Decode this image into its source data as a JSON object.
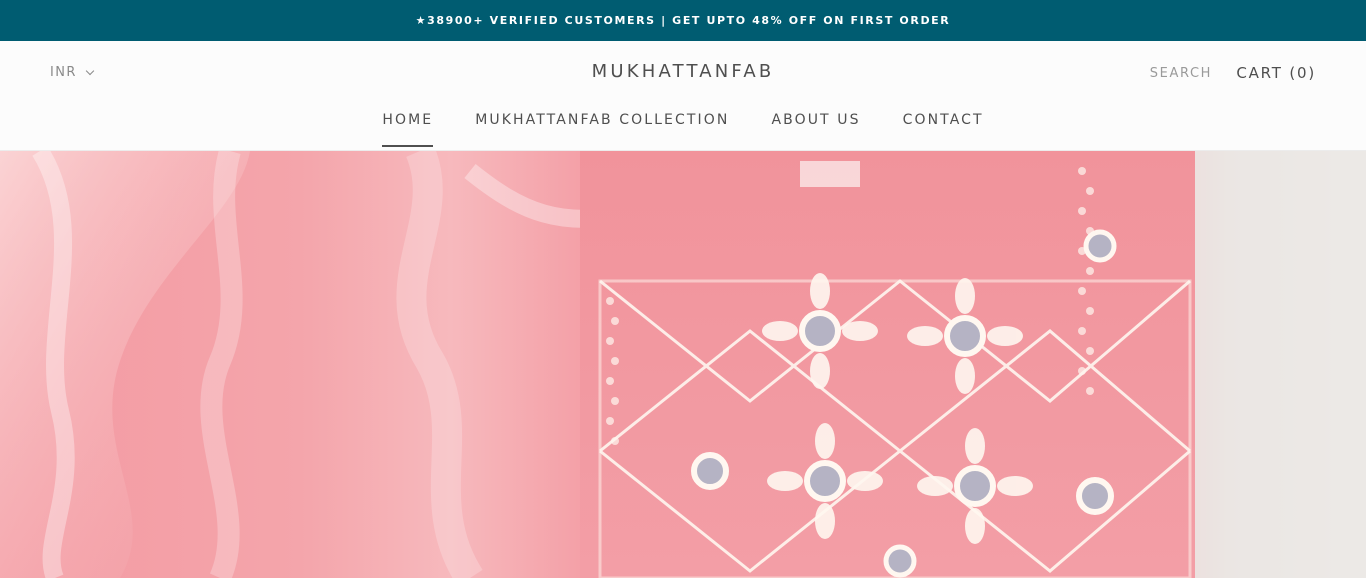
{
  "announcement": {
    "text": "★38900+ VERIFIED CUSTOMERS | GET UPTO 48% OFF ON FIRST ORDER",
    "background": "#005c71"
  },
  "header": {
    "currency": "INR",
    "logo": "MUKHATTANFAB",
    "search_label": "SEARCH",
    "cart_label": "CART (0)"
  },
  "nav": {
    "items": [
      {
        "label": "HOME",
        "active": true
      },
      {
        "label": "MUKHATTANFAB COLLECTION",
        "active": false
      },
      {
        "label": "ABOUT US",
        "active": false
      },
      {
        "label": "CONTACT",
        "active": false
      }
    ]
  },
  "hero": {
    "description_colors": [
      "#f39aa2",
      "#f7b9bd",
      "#fff6f4",
      "#ece9e6"
    ]
  }
}
